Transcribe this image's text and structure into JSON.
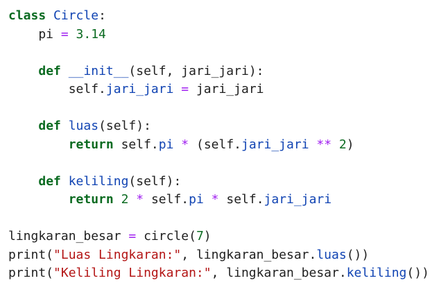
{
  "editor": {
    "lines": [
      [
        {
          "t": "class",
          "c": "tok-keyword"
        },
        {
          "t": " ",
          "c": ""
        },
        {
          "t": "Circle",
          "c": "tok-classname"
        },
        {
          "t": ":",
          "c": "tok-punct"
        }
      ],
      [
        {
          "t": "    pi ",
          "c": ""
        },
        {
          "t": "=",
          "c": "tok-op"
        },
        {
          "t": " ",
          "c": ""
        },
        {
          "t": "3.14",
          "c": "tok-number"
        }
      ],
      [],
      [
        {
          "t": "    ",
          "c": ""
        },
        {
          "t": "def",
          "c": "tok-keyword"
        },
        {
          "t": " ",
          "c": ""
        },
        {
          "t": "__init__",
          "c": "tok-magic"
        },
        {
          "t": "(self, jari_jari):",
          "c": "tok-punct"
        }
      ],
      [
        {
          "t": "        self.",
          "c": ""
        },
        {
          "t": "jari_jari",
          "c": "tok-attr"
        },
        {
          "t": " ",
          "c": ""
        },
        {
          "t": "=",
          "c": "tok-op"
        },
        {
          "t": " jari_jari",
          "c": ""
        }
      ],
      [],
      [
        {
          "t": "    ",
          "c": ""
        },
        {
          "t": "def",
          "c": "tok-keyword"
        },
        {
          "t": " ",
          "c": ""
        },
        {
          "t": "luas",
          "c": "tok-func"
        },
        {
          "t": "(self):",
          "c": "tok-punct"
        }
      ],
      [
        {
          "t": "        ",
          "c": ""
        },
        {
          "t": "return",
          "c": "tok-keyword"
        },
        {
          "t": " self.",
          "c": ""
        },
        {
          "t": "pi",
          "c": "tok-attr"
        },
        {
          "t": " ",
          "c": ""
        },
        {
          "t": "*",
          "c": "tok-op"
        },
        {
          "t": " (self.",
          "c": ""
        },
        {
          "t": "jari_jari",
          "c": "tok-attr"
        },
        {
          "t": " ",
          "c": ""
        },
        {
          "t": "**",
          "c": "tok-op"
        },
        {
          "t": " ",
          "c": ""
        },
        {
          "t": "2",
          "c": "tok-number"
        },
        {
          "t": ")",
          "c": "tok-punct"
        }
      ],
      [],
      [
        {
          "t": "    ",
          "c": ""
        },
        {
          "t": "def",
          "c": "tok-keyword"
        },
        {
          "t": " ",
          "c": ""
        },
        {
          "t": "keliling",
          "c": "tok-func"
        },
        {
          "t": "(self):",
          "c": "tok-punct"
        }
      ],
      [
        {
          "t": "        ",
          "c": ""
        },
        {
          "t": "return",
          "c": "tok-keyword"
        },
        {
          "t": " ",
          "c": ""
        },
        {
          "t": "2",
          "c": "tok-number"
        },
        {
          "t": " ",
          "c": ""
        },
        {
          "t": "*",
          "c": "tok-op"
        },
        {
          "t": " self.",
          "c": ""
        },
        {
          "t": "pi",
          "c": "tok-attr"
        },
        {
          "t": " ",
          "c": ""
        },
        {
          "t": "*",
          "c": "tok-op"
        },
        {
          "t": " self.",
          "c": ""
        },
        {
          "t": "jari_jari",
          "c": "tok-attr"
        }
      ],
      [],
      [
        {
          "t": "lingkaran_besar ",
          "c": ""
        },
        {
          "t": "=",
          "c": "tok-op"
        },
        {
          "t": " circle(",
          "c": ""
        },
        {
          "t": "7",
          "c": "tok-number"
        },
        {
          "t": ")",
          "c": "tok-punct"
        }
      ],
      [
        {
          "t": "print(",
          "c": ""
        },
        {
          "t": "\"Luas Lingkaran:\"",
          "c": "tok-string"
        },
        {
          "t": ", lingkaran_besar.",
          "c": ""
        },
        {
          "t": "luas",
          "c": "tok-attr"
        },
        {
          "t": "())",
          "c": "tok-punct"
        }
      ],
      [
        {
          "t": "print(",
          "c": ""
        },
        {
          "t": "\"Keliling Lingkaran:\"",
          "c": "tok-string"
        },
        {
          "t": ", lingkaran_besar.",
          "c": ""
        },
        {
          "t": "keliling",
          "c": "tok-attr"
        },
        {
          "t": "())",
          "c": "tok-punct"
        }
      ]
    ]
  }
}
